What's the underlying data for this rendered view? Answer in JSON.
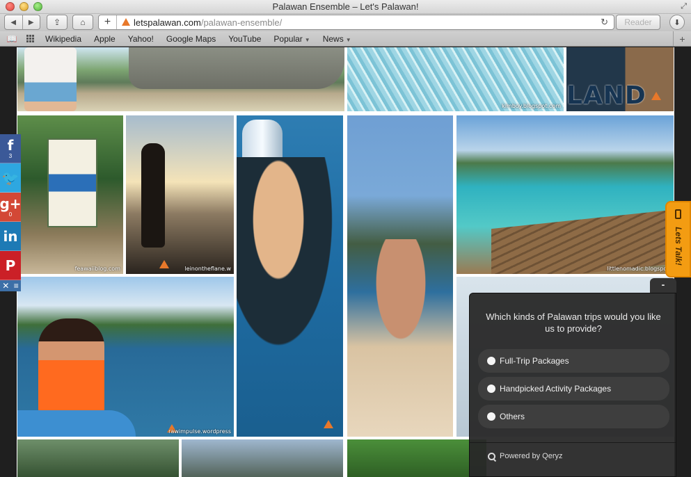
{
  "window": {
    "title": "Palawan Ensemble – Let's Palawan!"
  },
  "toolbar": {
    "url_domain": "letspalawan.com",
    "url_path": "/palawan-ensemble/",
    "reader_label": "Reader"
  },
  "bookmarks": [
    {
      "label": "Wikipedia"
    },
    {
      "label": "Apple"
    },
    {
      "label": "Yahoo!"
    },
    {
      "label": "Google Maps"
    },
    {
      "label": "YouTube"
    },
    {
      "label": "Popular",
      "menu": true
    },
    {
      "label": "News",
      "menu": true
    }
  ],
  "gallery": {
    "tiles": [
      {
        "watermark": ""
      },
      {
        "watermark": "kimboy.blogspot.com"
      },
      {
        "watermark": ""
      },
      {
        "watermark": "feawaiiblog.com"
      },
      {
        "watermark": "leinontheflane.w"
      },
      {
        "watermark": ""
      },
      {
        "watermark": ""
      },
      {
        "watermark": "littlenomadic.blogspot."
      },
      {
        "watermark": "rawimpulse.wordpress"
      }
    ],
    "land_text": "LAND"
  },
  "social": {
    "facebook": {
      "glyph": "f",
      "count": "3"
    },
    "twitter": {
      "glyph": "t"
    },
    "googleplus": {
      "glyph": "g+",
      "count": "0"
    },
    "linkedin": {
      "glyph": "in"
    },
    "pinterest": {
      "glyph": "P"
    }
  },
  "talk_tab": {
    "label": "Lets Talk!"
  },
  "survey": {
    "minimize_label": "-",
    "question": "Which kinds of Palawan trips would you like us to provide?",
    "options": [
      {
        "label": "Full-Trip Packages"
      },
      {
        "label": "Handpicked Activity Packages"
      },
      {
        "label": "Others"
      }
    ],
    "powered_by": "Powered by Qeryz"
  },
  "colors": {
    "facebook": "#3b5998",
    "twitter": "#2ea7e0",
    "googleplus": "#d34836",
    "linkedin": "#1d7ab5",
    "pinterest": "#cb2027",
    "talk_tab": "#f39c12"
  }
}
